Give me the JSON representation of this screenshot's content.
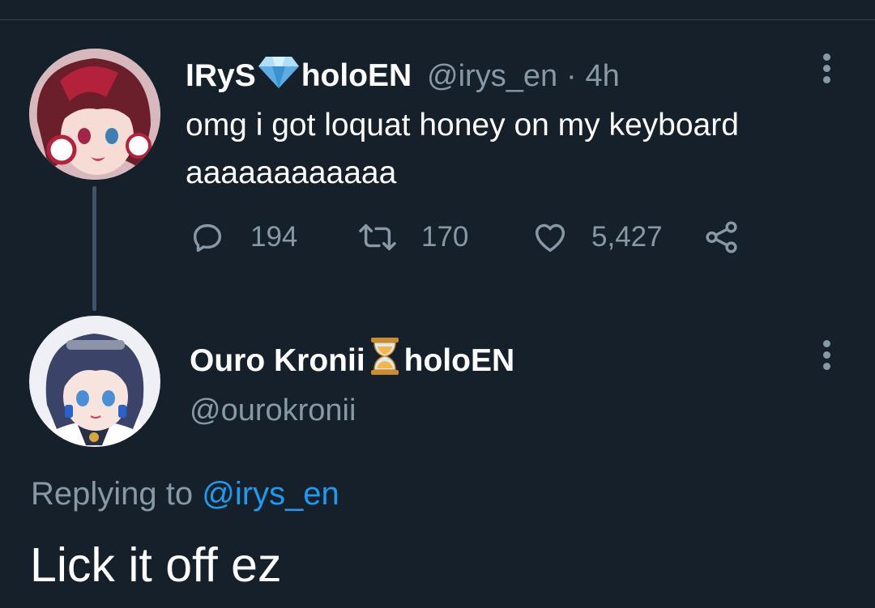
{
  "colors": {
    "background": "#15202b",
    "text_primary": "#ffffff",
    "text_secondary": "#8899a6",
    "link": "#1d9bf0"
  },
  "tweet": {
    "author_name": "IRyS",
    "author_badge_icon": "diamond-emoji",
    "author_suffix": "holoEN",
    "handle": "@irys_en",
    "separator": "·",
    "time": "4h",
    "text_line1": "omg i got loquat honey on my keyboard",
    "text_line2": "aaaaaaaaaaaa",
    "reply_count": "194",
    "retweet_count": "170",
    "like_count": "5,427"
  },
  "reply": {
    "author_name": "Ouro Kronii",
    "author_badge_icon": "hourglass-emoji",
    "author_suffix": "holoEN",
    "handle": "@ourokronii",
    "replying_to_label": "Replying to",
    "replying_to_handle": "@irys_en",
    "text": "Lick it off ez"
  }
}
